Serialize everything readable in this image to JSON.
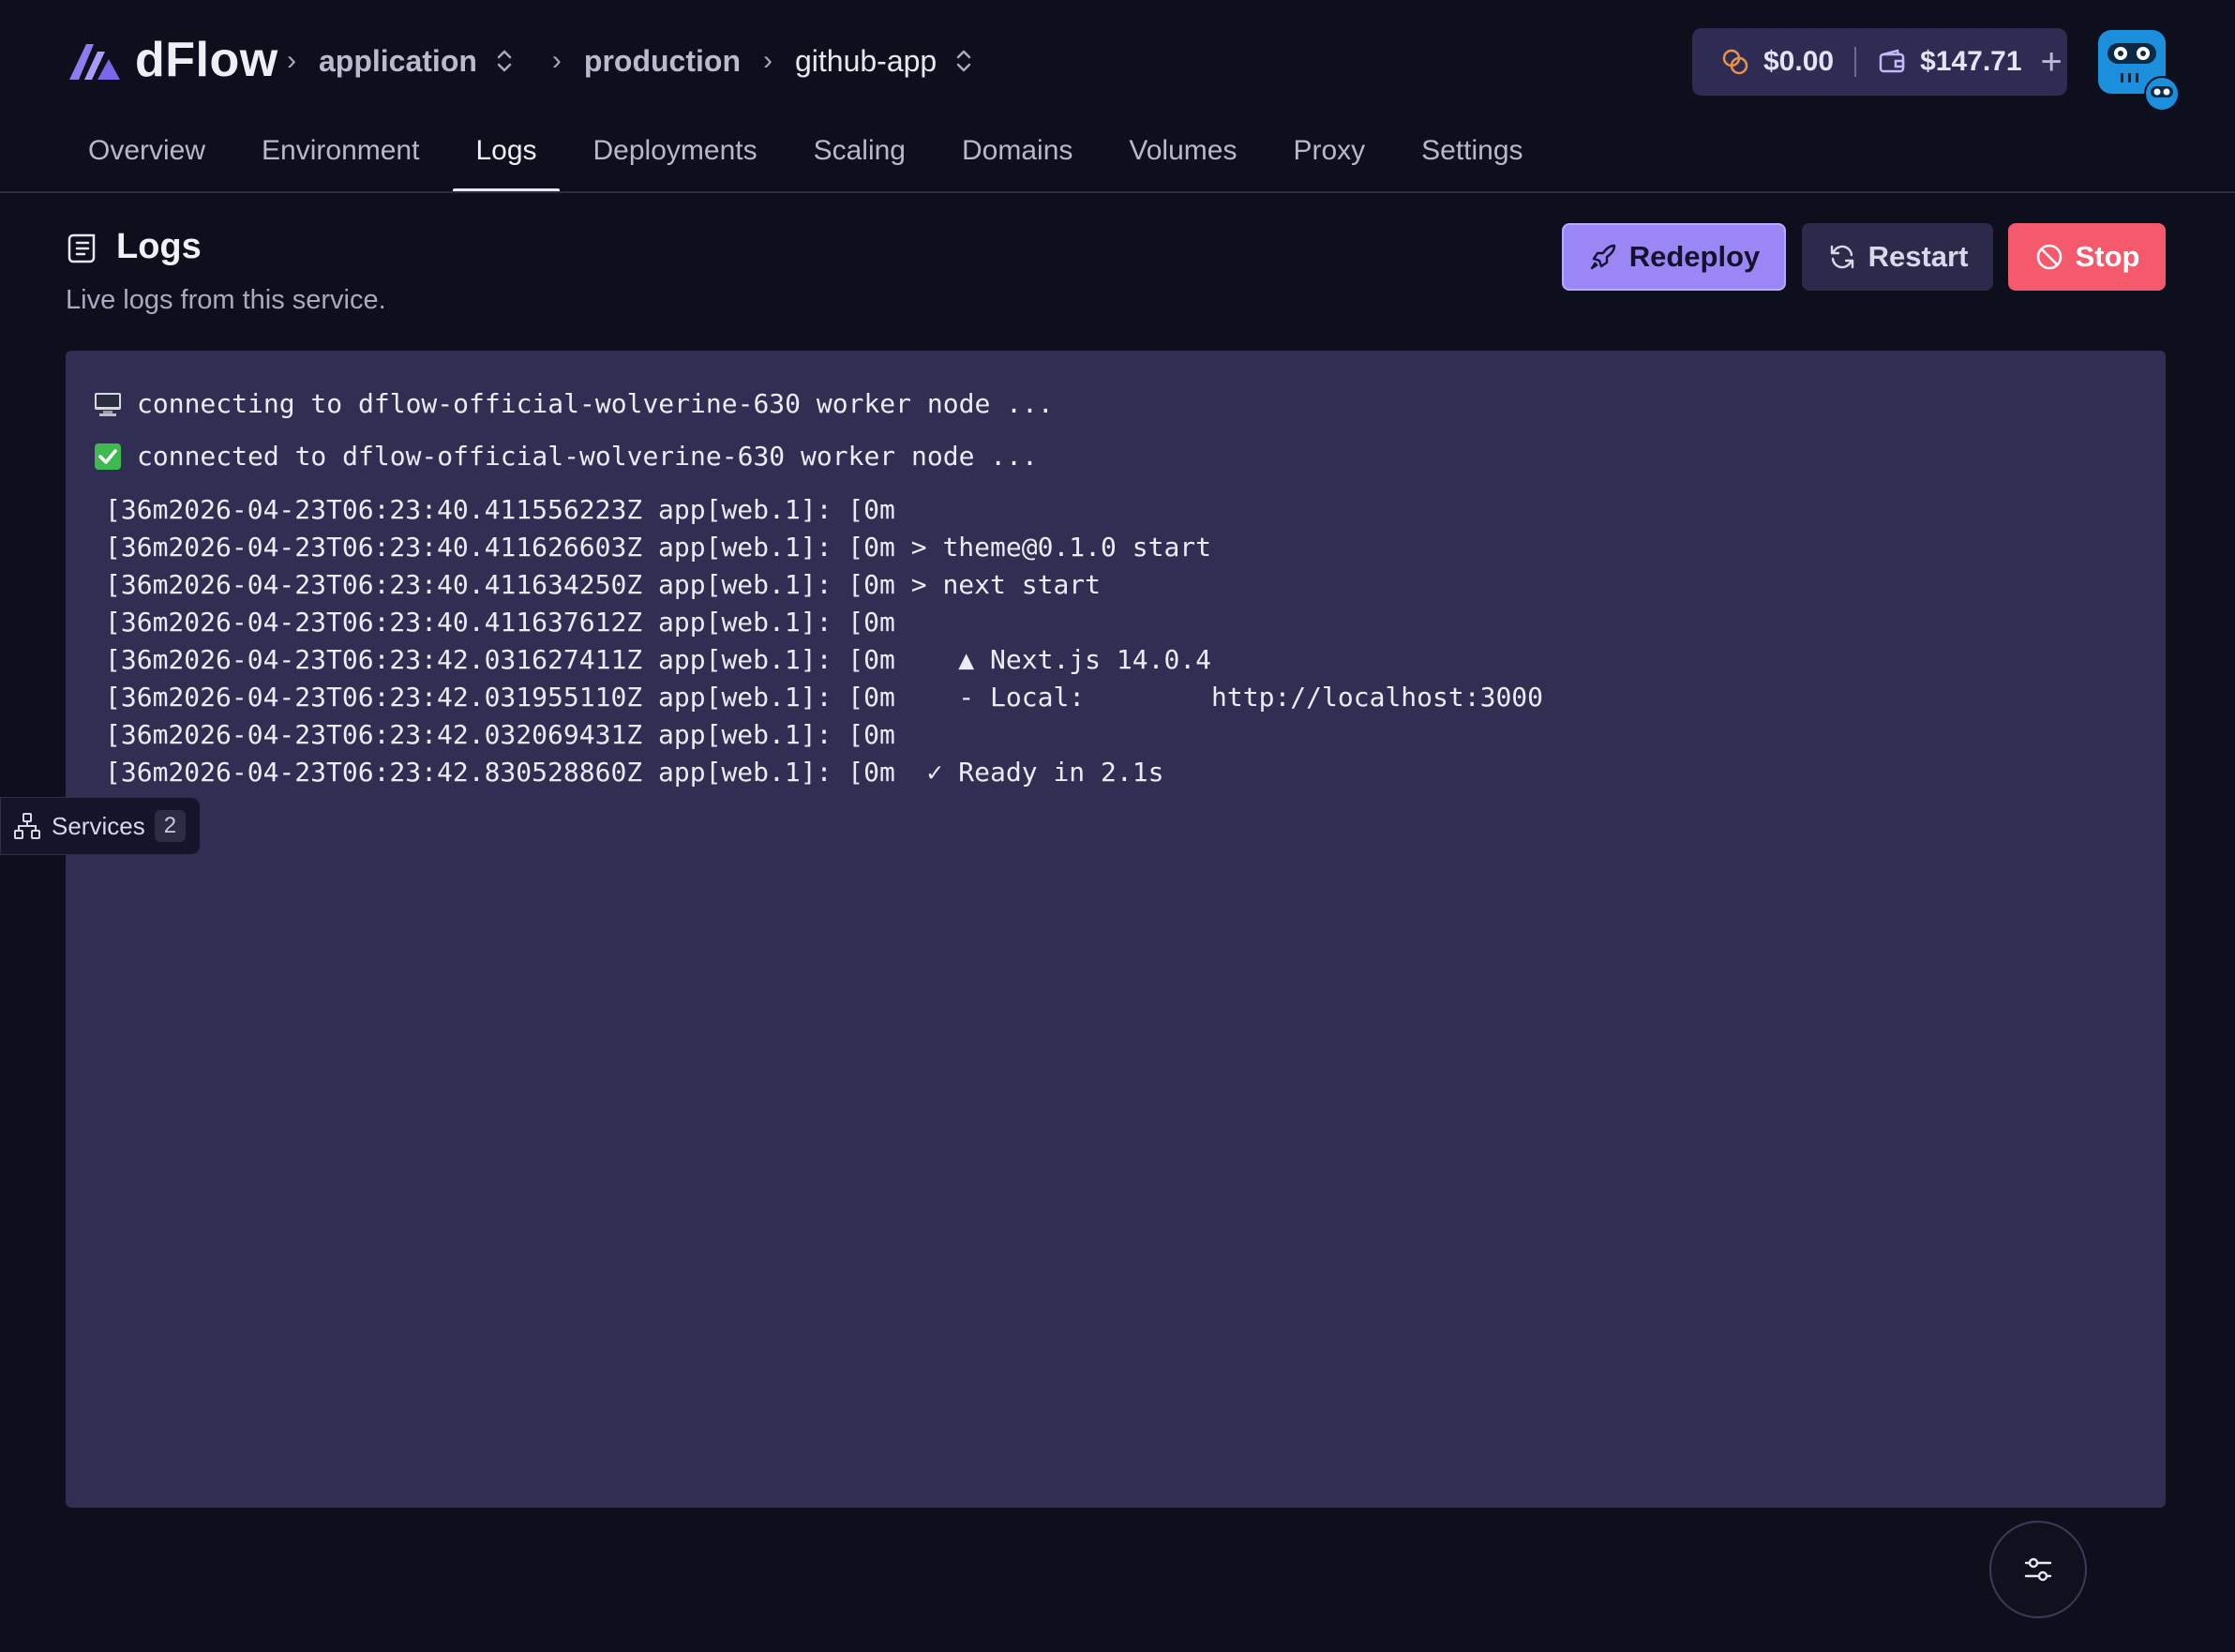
{
  "brand": {
    "name": "dFlow"
  },
  "breadcrumb": {
    "project": "application",
    "environment": "production",
    "service": "github-app"
  },
  "wallet": {
    "credits": "$0.00",
    "balance": "$147.71",
    "add_label": "+"
  },
  "tabs": [
    {
      "label": "Overview"
    },
    {
      "label": "Environment"
    },
    {
      "label": "Logs",
      "active": true
    },
    {
      "label": "Deployments"
    },
    {
      "label": "Scaling"
    },
    {
      "label": "Domains"
    },
    {
      "label": "Volumes"
    },
    {
      "label": "Proxy"
    },
    {
      "label": "Settings"
    }
  ],
  "section": {
    "title": "Logs",
    "subtitle": "Live logs from this service."
  },
  "actions": {
    "redeploy": "Redeploy",
    "restart": "Restart",
    "stop": "Stop"
  },
  "log_status": [
    {
      "icon": "computer-icon",
      "text": "connecting to dflow-official-wolverine-630 worker node ..."
    },
    {
      "icon": "checkmark-icon",
      "text": "connected to dflow-official-wolverine-630 worker node ..."
    }
  ],
  "logs": [
    "[36m2026-04-23T06:23:40.411556223Z app[web.1]: [0m",
    "[36m2026-04-23T06:23:40.411626603Z app[web.1]: [0m > theme@0.1.0 start",
    "[36m2026-04-23T06:23:40.411634250Z app[web.1]: [0m > next start",
    "[36m2026-04-23T06:23:40.411637612Z app[web.1]: [0m",
    "[36m2026-04-23T06:23:42.031627411Z app[web.1]: [0m    ▲ Next.js 14.0.4",
    "[36m2026-04-23T06:23:42.031955110Z app[web.1]: [0m    - Local:        http://localhost:3000",
    "[36m2026-04-23T06:23:42.032069431Z app[web.1]: [0m",
    "[36m2026-04-23T06:23:42.830528860Z app[web.1]: [0m  ✓ Ready in 2.1s"
  ],
  "services": {
    "label": "Services",
    "count": "2"
  },
  "colors": {
    "background": "#0e0f1c",
    "log_panel": "#302f53",
    "accent": "#9a86f5",
    "danger": "#f55a6c"
  }
}
